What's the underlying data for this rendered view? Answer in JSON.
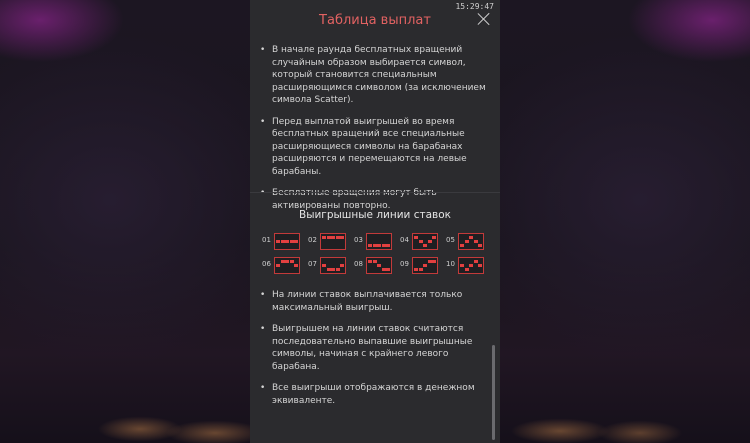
{
  "clock": "15:29:47",
  "header": {
    "title": "Таблица выплат"
  },
  "free_spins": {
    "items": [
      "В начале раунда бесплатных вращений случайным образом выбирается символ, который становится специальным расширяющимся символом (за исключением символа Scatter).",
      "Перед выплатой выигрышей во время бесплатных вращений все специальные расширяющиеся символы на барабанах расширяются и перемещаются на левые барабаны.",
      "Бесплатные вращения могут быть активированы повторно."
    ]
  },
  "paylines": {
    "title": "Выигрышные линии ставок",
    "lines": [
      {
        "label": "01",
        "pattern": [
          1,
          1,
          1,
          1,
          1
        ]
      },
      {
        "label": "02",
        "pattern": [
          0,
          0,
          0,
          0,
          0
        ]
      },
      {
        "label": "03",
        "pattern": [
          2,
          2,
          2,
          2,
          2
        ]
      },
      {
        "label": "04",
        "pattern": [
          0,
          1,
          2,
          1,
          0
        ]
      },
      {
        "label": "05",
        "pattern": [
          2,
          1,
          0,
          1,
          2
        ]
      },
      {
        "label": "06",
        "pattern": [
          1,
          0,
          0,
          0,
          1
        ]
      },
      {
        "label": "07",
        "pattern": [
          1,
          2,
          2,
          2,
          1
        ]
      },
      {
        "label": "08",
        "pattern": [
          0,
          0,
          1,
          2,
          2
        ]
      },
      {
        "label": "09",
        "pattern": [
          2,
          2,
          1,
          0,
          0
        ]
      },
      {
        "label": "10",
        "pattern": [
          1,
          2,
          1,
          0,
          1
        ]
      }
    ]
  },
  "rules": {
    "items": [
      "На линии ставок выплачивается только максимальный выигрыш.",
      "Выигрышем на линии ставок считаются последовательно выпавшие выигрышные символы, начиная с крайнего левого барабана.",
      "Все выигрыши отображаются в денежном эквиваленте."
    ]
  },
  "colors": {
    "title": "#e26262",
    "panel": "#2b2b2e",
    "payline": "#e24040"
  }
}
